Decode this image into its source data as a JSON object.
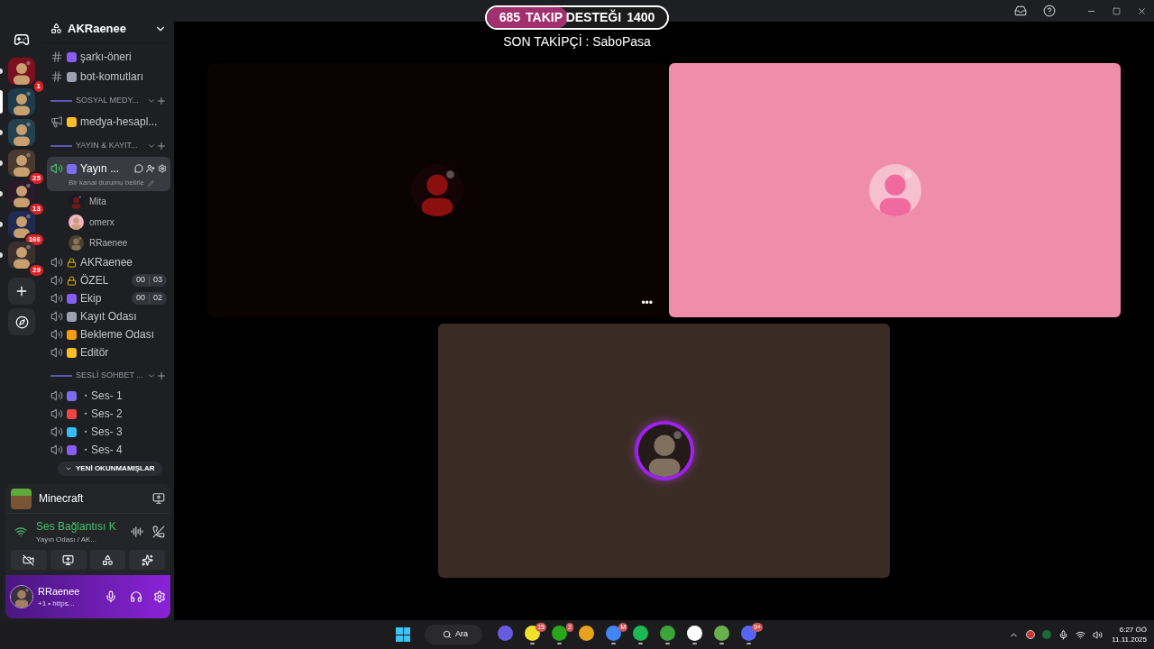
{
  "overlay": {
    "current": "685",
    "label": "TAKIP DESTEĞI",
    "goal": "1400",
    "level": 0.45,
    "last_follower": "SON TAKİPÇİ : SaboPasa"
  },
  "servers": [
    {
      "badge": "1",
      "selected": false
    },
    {
      "selected": true
    },
    {
      "selected": false
    },
    {
      "badge": "25",
      "selected": false
    },
    {
      "badge": "13",
      "selected": false
    },
    {
      "badge": "166",
      "selected": false
    },
    {
      "badge": "29",
      "selected": false
    }
  ],
  "server": {
    "name": "AKRaenee"
  },
  "channels": [
    {
      "kind": "text",
      "name": "şarkı-öneri"
    },
    {
      "kind": "text",
      "name": "bot-komutları"
    },
    {
      "kind": "category",
      "name": "SOSYAL MEDY..."
    },
    {
      "kind": "announcement",
      "name": "medya-hesapl..."
    },
    {
      "kind": "category",
      "name": "YAYIN & KAYIT..."
    },
    {
      "kind": "voice",
      "name": "Yayın ...",
      "selected": true,
      "locked": false,
      "status": "Bir kanal durumu belirle",
      "users": [
        {
          "name": "Mita"
        },
        {
          "name": "omerx"
        },
        {
          "name": "RRaenee"
        }
      ]
    },
    {
      "kind": "voice",
      "name": "AKRaenee",
      "selected": false,
      "locked": true
    },
    {
      "kind": "voice",
      "name": "ÖZEL",
      "selected": false,
      "locked": true,
      "counter": [
        "00",
        "03"
      ]
    },
    {
      "kind": "voice",
      "name": "Ekip",
      "selected": false,
      "locked": false,
      "counter": [
        "00",
        "02"
      ]
    },
    {
      "kind": "voice",
      "name": "Kayıt Odası",
      "selected": false,
      "locked": false
    },
    {
      "kind": "voice",
      "name": "Bekleme Odası",
      "selected": false,
      "locked": false
    },
    {
      "kind": "voice",
      "name": "Editör",
      "selected": false,
      "locked": false
    },
    {
      "kind": "category",
      "name": "SESLİ SOHBET ..."
    },
    {
      "kind": "voice",
      "name": "・Ses- 1",
      "selected": false,
      "locked": false
    },
    {
      "kind": "voice",
      "name": "・Ses- 2",
      "selected": false,
      "locked": false
    },
    {
      "kind": "voice",
      "name": "・Ses- 3",
      "selected": false,
      "locked": false
    },
    {
      "kind": "voice",
      "name": "・Ses- 4",
      "selected": false,
      "locked": false
    }
  ],
  "unread_pill": "YENİ OKUNMAMIŞLAR",
  "activity": {
    "name": "Minecraft"
  },
  "voice": {
    "status": "Ses Bağlantısı K",
    "channel": "Yayın Odası / AK..."
  },
  "user": {
    "name": "RRaenee",
    "status": "+1 • https..."
  },
  "tiles": [
    {
      "speaking": false,
      "menu": "•••"
    },
    {
      "speaking": false
    },
    {
      "speaking": true
    }
  ],
  "taskbar": {
    "search": "Ara",
    "apps": [
      {
        "running": false
      },
      {
        "badge": "15",
        "running": true
      },
      {
        "badge": "2",
        "running": true
      },
      {
        "running": false
      },
      {
        "badge": "M",
        "running": true
      },
      {
        "running": true
      },
      {
        "running": true
      },
      {
        "running": true
      },
      {
        "running": true
      },
      {
        "badge": "9+",
        "running": true
      }
    ],
    "time": "6:27 ÖÖ",
    "date": "11.11.2025"
  }
}
